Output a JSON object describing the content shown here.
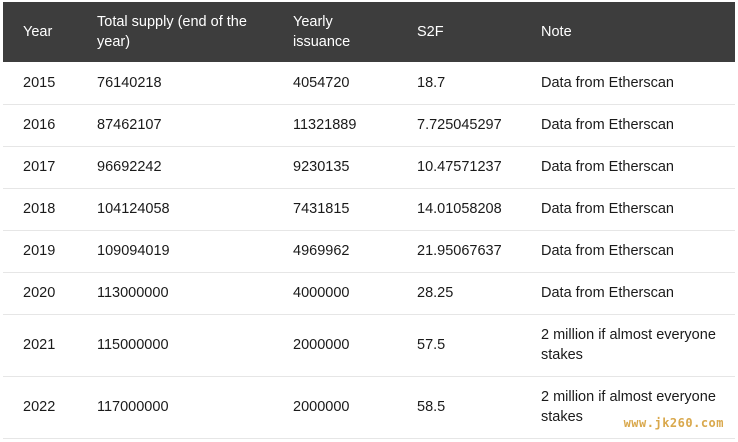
{
  "table": {
    "headers": {
      "year": "Year",
      "supply": "Total supply (end of the year)",
      "issuance": "Yearly issuance",
      "s2f": "S2F",
      "note": "Note"
    },
    "rows": [
      {
        "year": "2015",
        "supply": "76140218",
        "issuance": "4054720",
        "s2f": "18.7",
        "note": "Data from Etherscan"
      },
      {
        "year": "2016",
        "supply": "87462107",
        "issuance": "11321889",
        "s2f": "7.725045297",
        "note": "Data from Etherscan"
      },
      {
        "year": "2017",
        "supply": "96692242",
        "issuance": "9230135",
        "s2f": "10.47571237",
        "note": "Data from Etherscan"
      },
      {
        "year": "2018",
        "supply": "104124058",
        "issuance": "7431815",
        "s2f": "14.01058208",
        "note": "Data from Etherscan"
      },
      {
        "year": "2019",
        "supply": "109094019",
        "issuance": "4969962",
        "s2f": "21.95067637",
        "note": "Data from Etherscan"
      },
      {
        "year": "2020",
        "supply": "113000000",
        "issuance": "4000000",
        "s2f": "28.25",
        "note": "Data from Etherscan"
      },
      {
        "year": "2021",
        "supply": "115000000",
        "issuance": "2000000",
        "s2f": "57.5",
        "note": "2 million if almost everyone stakes"
      },
      {
        "year": "2022",
        "supply": "117000000",
        "issuance": "2000000",
        "s2f": "58.5",
        "note": "2 million if almost everyone stakes"
      }
    ]
  },
  "watermark": "www.jk260.com",
  "colors": {
    "header_bg": "#3d3d3d",
    "header_text": "#ffffff",
    "row_border": "#e6e6e6",
    "watermark": "#d9a84c"
  }
}
